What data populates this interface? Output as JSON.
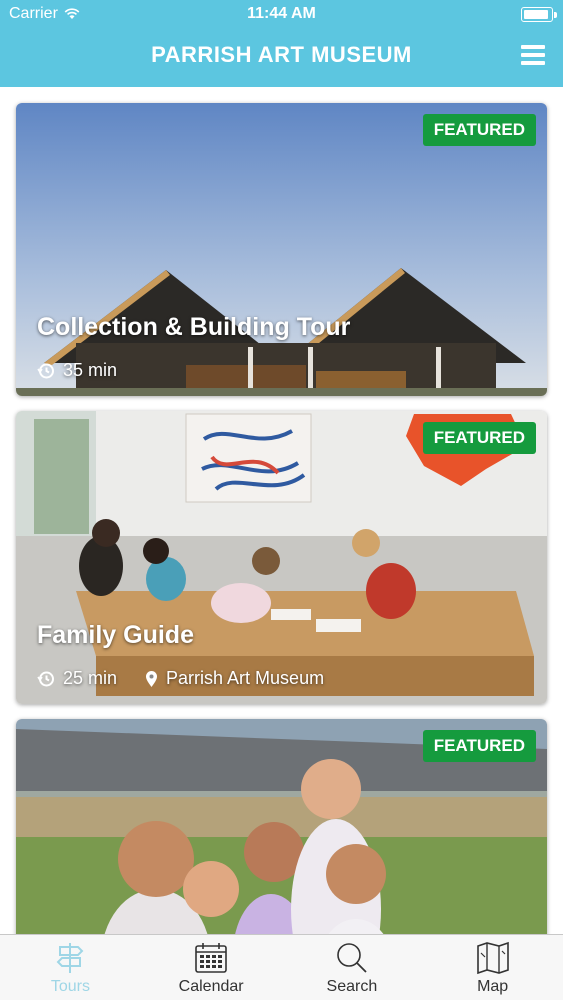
{
  "status_bar": {
    "carrier": "Carrier",
    "time": "11:44 AM"
  },
  "header": {
    "title": "PARRISH ART MUSEUM",
    "menu_icon": "hamburger-menu-icon"
  },
  "colors": {
    "header": "#5cc6e0",
    "badge": "#159b3e",
    "tab_active": "#9fd6e6"
  },
  "tours": [
    {
      "badge": "FEATURED",
      "title": "Collection & Building Tour",
      "duration": "35 min"
    },
    {
      "badge": "FEATURED",
      "title": "Family Guide",
      "duration": "25 min",
      "location": "Parrish Art Museum"
    },
    {
      "badge": "FEATURED"
    }
  ],
  "tabs": [
    {
      "label": "Tours",
      "icon": "signpost-icon",
      "active": true
    },
    {
      "label": "Calendar",
      "icon": "calendar-icon",
      "active": false
    },
    {
      "label": "Search",
      "icon": "search-icon",
      "active": false
    },
    {
      "label": "Map",
      "icon": "map-icon",
      "active": false
    }
  ]
}
